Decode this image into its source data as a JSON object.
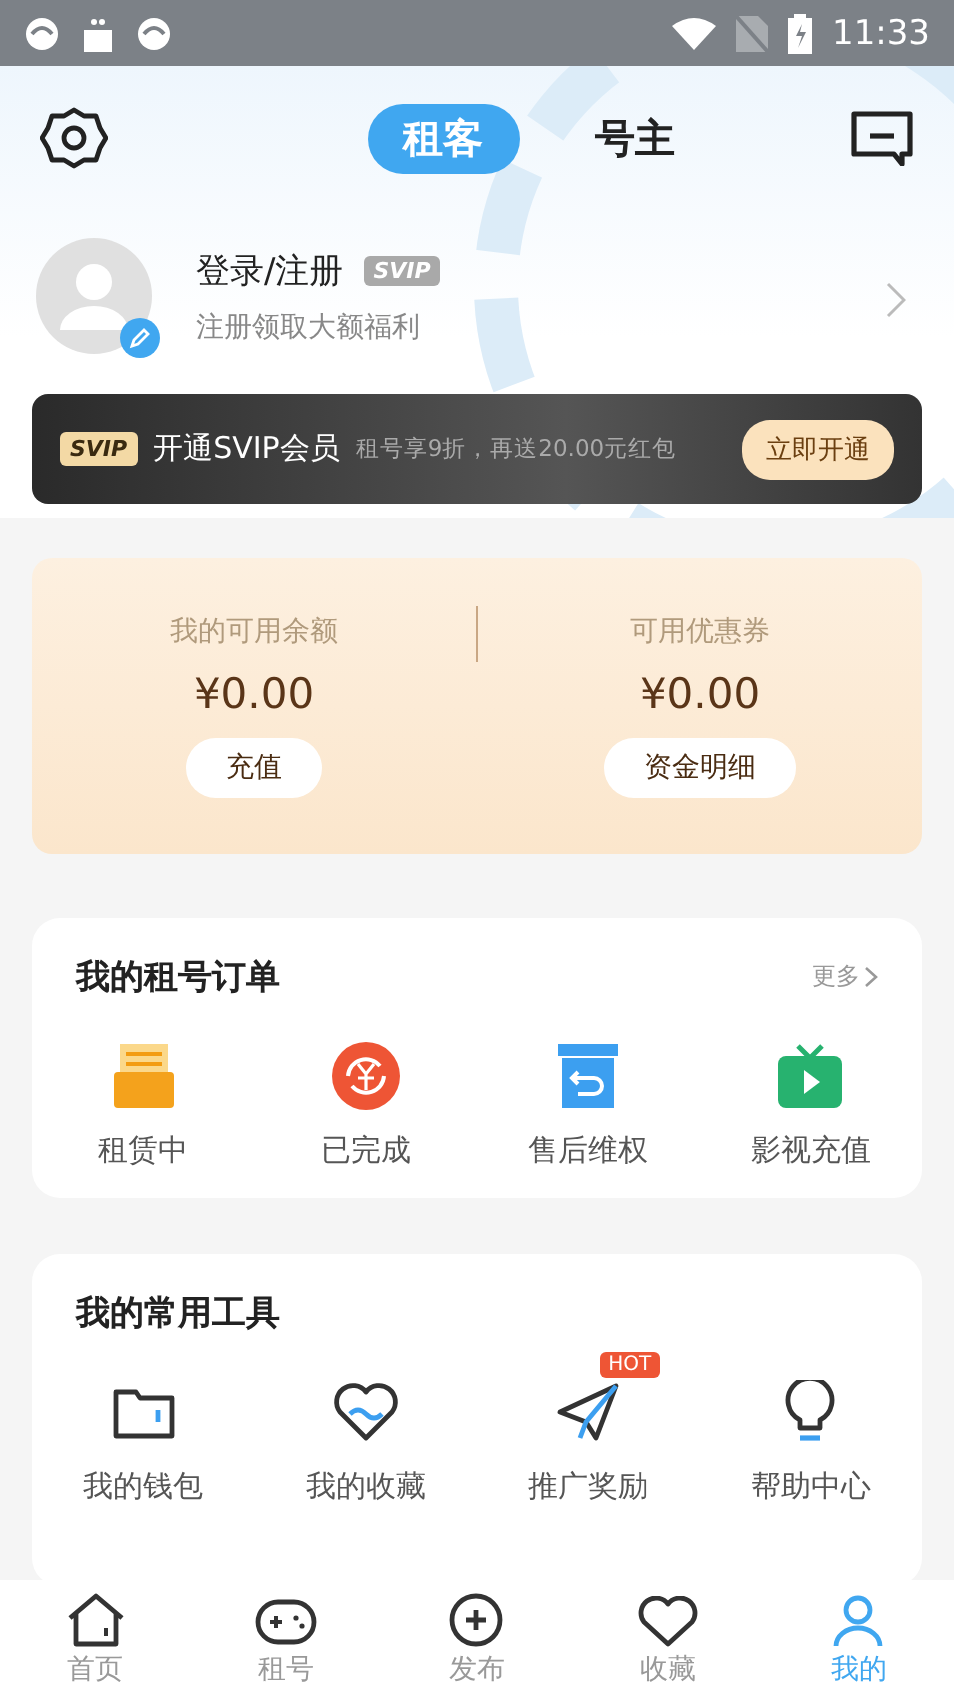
{
  "status_bar": {
    "time": "11:33"
  },
  "header": {
    "tabs": [
      {
        "label": "租客",
        "selected": true
      },
      {
        "label": "号主",
        "selected": false
      }
    ]
  },
  "profile": {
    "name": "登录/注册",
    "badge": "SVIP",
    "subtitle": "注册领取大额福利"
  },
  "svip_banner": {
    "badge": "SVIP",
    "title": "开通SVIP会员",
    "description": "租号享9折，再送20.00元红包",
    "button": "立即开通"
  },
  "wallet": {
    "columns": [
      {
        "label": "我的可用余额",
        "amount": "¥0.00",
        "button": "充值"
      },
      {
        "label": "可用优惠券",
        "amount": "¥0.00",
        "button": "资金明细"
      }
    ]
  },
  "orders": {
    "title": "我的租号订单",
    "more": "更多",
    "items": [
      {
        "kind": "renting",
        "label": "租赁中"
      },
      {
        "kind": "done",
        "label": "已完成"
      },
      {
        "kind": "aftersale",
        "label": "售后维权"
      },
      {
        "kind": "video",
        "label": "影视充值"
      }
    ]
  },
  "tools": {
    "title": "我的常用工具",
    "items": [
      {
        "kind": "wallet",
        "label": "我的钱包"
      },
      {
        "kind": "favorite",
        "label": "我的收藏"
      },
      {
        "kind": "promote",
        "label": "推广奖励",
        "badge": "HOT"
      },
      {
        "kind": "help",
        "label": "帮助中心"
      }
    ]
  },
  "bottom_nav": [
    {
      "kind": "home",
      "label": "首页",
      "selected": false
    },
    {
      "kind": "game",
      "label": "租号",
      "selected": false
    },
    {
      "kind": "publish",
      "label": "发布",
      "selected": false
    },
    {
      "kind": "favorite",
      "label": "收藏",
      "selected": false
    },
    {
      "kind": "me",
      "label": "我的",
      "selected": true
    }
  ]
}
